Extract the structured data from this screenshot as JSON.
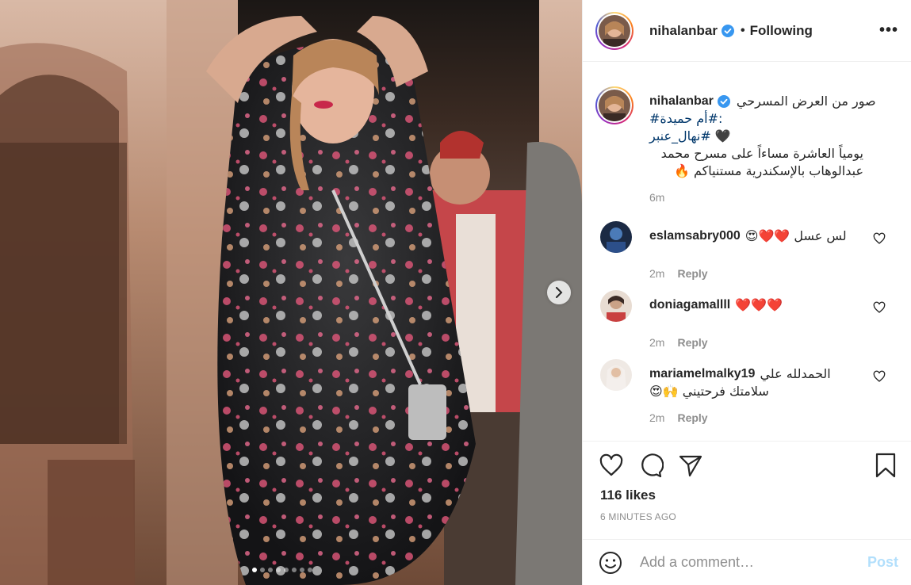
{
  "post": {
    "username": "nihalanbar",
    "follow_separator": "•",
    "follow_status": "Following",
    "more_label": "•••",
    "image_count": 8,
    "active_image": 1
  },
  "caption": {
    "username": "nihalanbar",
    "line1": "صور من العرض المسرحي",
    "line2": ":#أم حميدة#",
    "line3_tag": "#نهال_عنبر",
    "line3_emoji": "🖤",
    "line4": "يومياً العاشرة مساءاً على مسرح محمد",
    "line5": "عبدالوهاب بالإسكندرية مستنياكم 🔥",
    "time": "6m"
  },
  "comments": [
    {
      "username": "eslamsabry000",
      "text": "لس عسل ❤️❤️😍",
      "time": "2m",
      "reply": "Reply"
    },
    {
      "username": "doniagamallll",
      "text": "❤️❤️❤️",
      "time": "2m",
      "reply": "Reply"
    },
    {
      "username": "mariamelmalky19",
      "text": "الحمدلله علي",
      "text2": "سلامتك فرحتيني 🙌😍",
      "time": "2m",
      "reply": "Reply"
    }
  ],
  "actions": {
    "likes": "116 likes",
    "time_ago": "6 MINUTES AGO"
  },
  "add_comment": {
    "placeholder": "Add a comment…",
    "post_label": "Post"
  },
  "icons": {
    "like": "heart-icon",
    "comment": "comment-icon",
    "share": "paper-plane-icon",
    "save": "bookmark-icon",
    "emoji": "smiley-icon",
    "next": "chevron-right-icon",
    "verified": "verified-badge-icon"
  },
  "colors": {
    "verified": "#3897f0",
    "link": "#00376b",
    "muted": "#8e8e8e",
    "post_disabled": "#b2dffc",
    "heart_red": "#ed4956"
  }
}
